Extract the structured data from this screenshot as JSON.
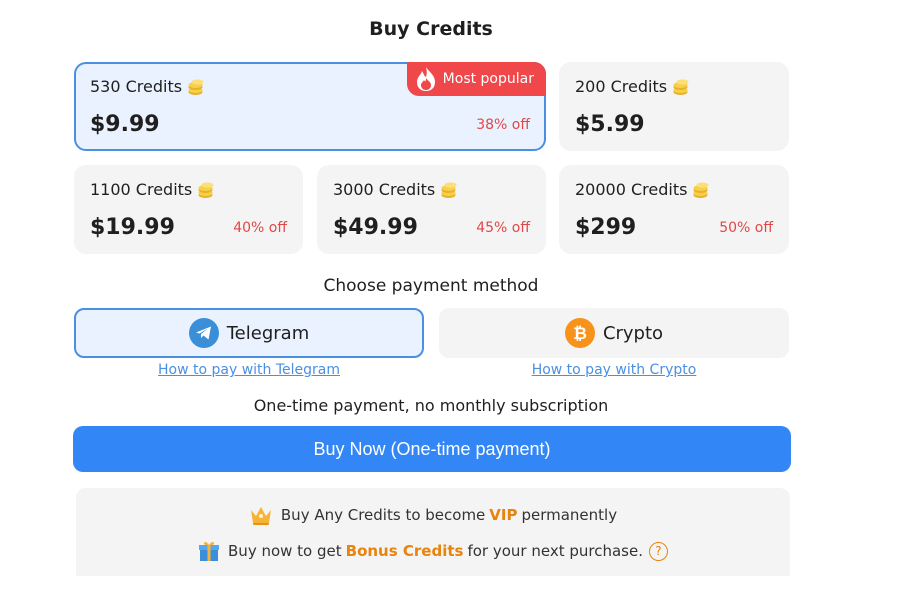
{
  "header": {
    "title": "Buy Credits"
  },
  "packages": [
    {
      "name": "530 Credits",
      "price": "$9.99",
      "discount": "38% off",
      "badge": "Most popular",
      "selected": true
    },
    {
      "name": "200 Credits",
      "price": "$5.99",
      "discount": "",
      "selected": false
    },
    {
      "name": "1100 Credits",
      "price": "$19.99",
      "discount": "40% off",
      "selected": false
    },
    {
      "name": "3000 Credits",
      "price": "$49.99",
      "discount": "45% off",
      "selected": false
    },
    {
      "name": "20000 Credits",
      "price": "$299",
      "discount": "50% off",
      "selected": false
    }
  ],
  "payment": {
    "title": "Choose payment method",
    "methods": [
      {
        "label": "Telegram",
        "icon": "telegram-icon",
        "howto": "How to pay with Telegram",
        "selected": true
      },
      {
        "label": "Crypto",
        "icon": "bitcoin-icon",
        "howto": "How to pay with Crypto",
        "selected": false
      }
    ]
  },
  "note": "One-time payment, no monthly subscription",
  "buy_button": "Buy Now (One-time payment)",
  "perks": {
    "vip": {
      "before": "Buy Any Credits to become",
      "highlight": "VIP",
      "after": "permanently"
    },
    "bonus": {
      "before": "Buy now to get",
      "highlight": "Bonus Credits",
      "after": "for your next purchase.",
      "help": "?"
    }
  },
  "colors": {
    "accent": "#3286f5",
    "selected_border": "#4a90e2",
    "discount": "#e04848",
    "highlight": "#e8830c",
    "badge": "#f0474a"
  }
}
